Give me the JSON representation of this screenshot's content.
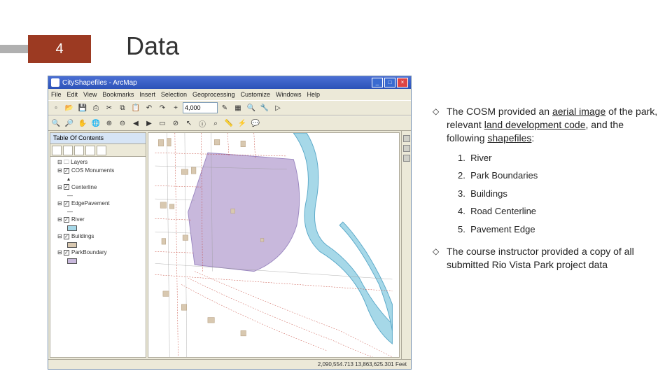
{
  "page_number": "4",
  "slide_title": "Data",
  "arcmap": {
    "window_title": "CityShapefiles - ArcMap",
    "menus": [
      "File",
      "Edit",
      "View",
      "Bookmarks",
      "Insert",
      "Selection",
      "Geoprocessing",
      "Customize",
      "Windows",
      "Help"
    ],
    "scale": "4,000",
    "toc_title": "Table Of Contents",
    "layers_root": "Layers",
    "layers": [
      {
        "name": "COS Monuments",
        "checked": true,
        "symbol": "point"
      },
      {
        "name": "Centerline",
        "checked": true,
        "symbol": "line"
      },
      {
        "name": "EdgePavement",
        "checked": true,
        "symbol": "line"
      },
      {
        "name": "River",
        "checked": true,
        "symbol": "fill",
        "color": "#a6d8e8"
      },
      {
        "name": "Buildings",
        "checked": true,
        "symbol": "fill",
        "color": "#d8c8b0"
      },
      {
        "name": "ParkBoundary",
        "checked": true,
        "symbol": "fill",
        "color": "#c8b8dc"
      }
    ],
    "status": "2,090,554.713 13,863,625.301 Feet"
  },
  "bullets": {
    "b1_pre": "The COSM provided an ",
    "b1_u1": "aerial image",
    "b1_mid1": " of the park, relevant ",
    "b1_u2": "land development code",
    "b1_mid2": ", and  the following ",
    "b1_u3": "shapefiles",
    "b1_post": ":",
    "list": [
      "River",
      "Park Boundaries",
      "Buildings",
      "Road Centerline",
      "Pavement Edge"
    ],
    "b2": "The course instructor provided a copy of all submitted Rio Vista Park project data"
  }
}
